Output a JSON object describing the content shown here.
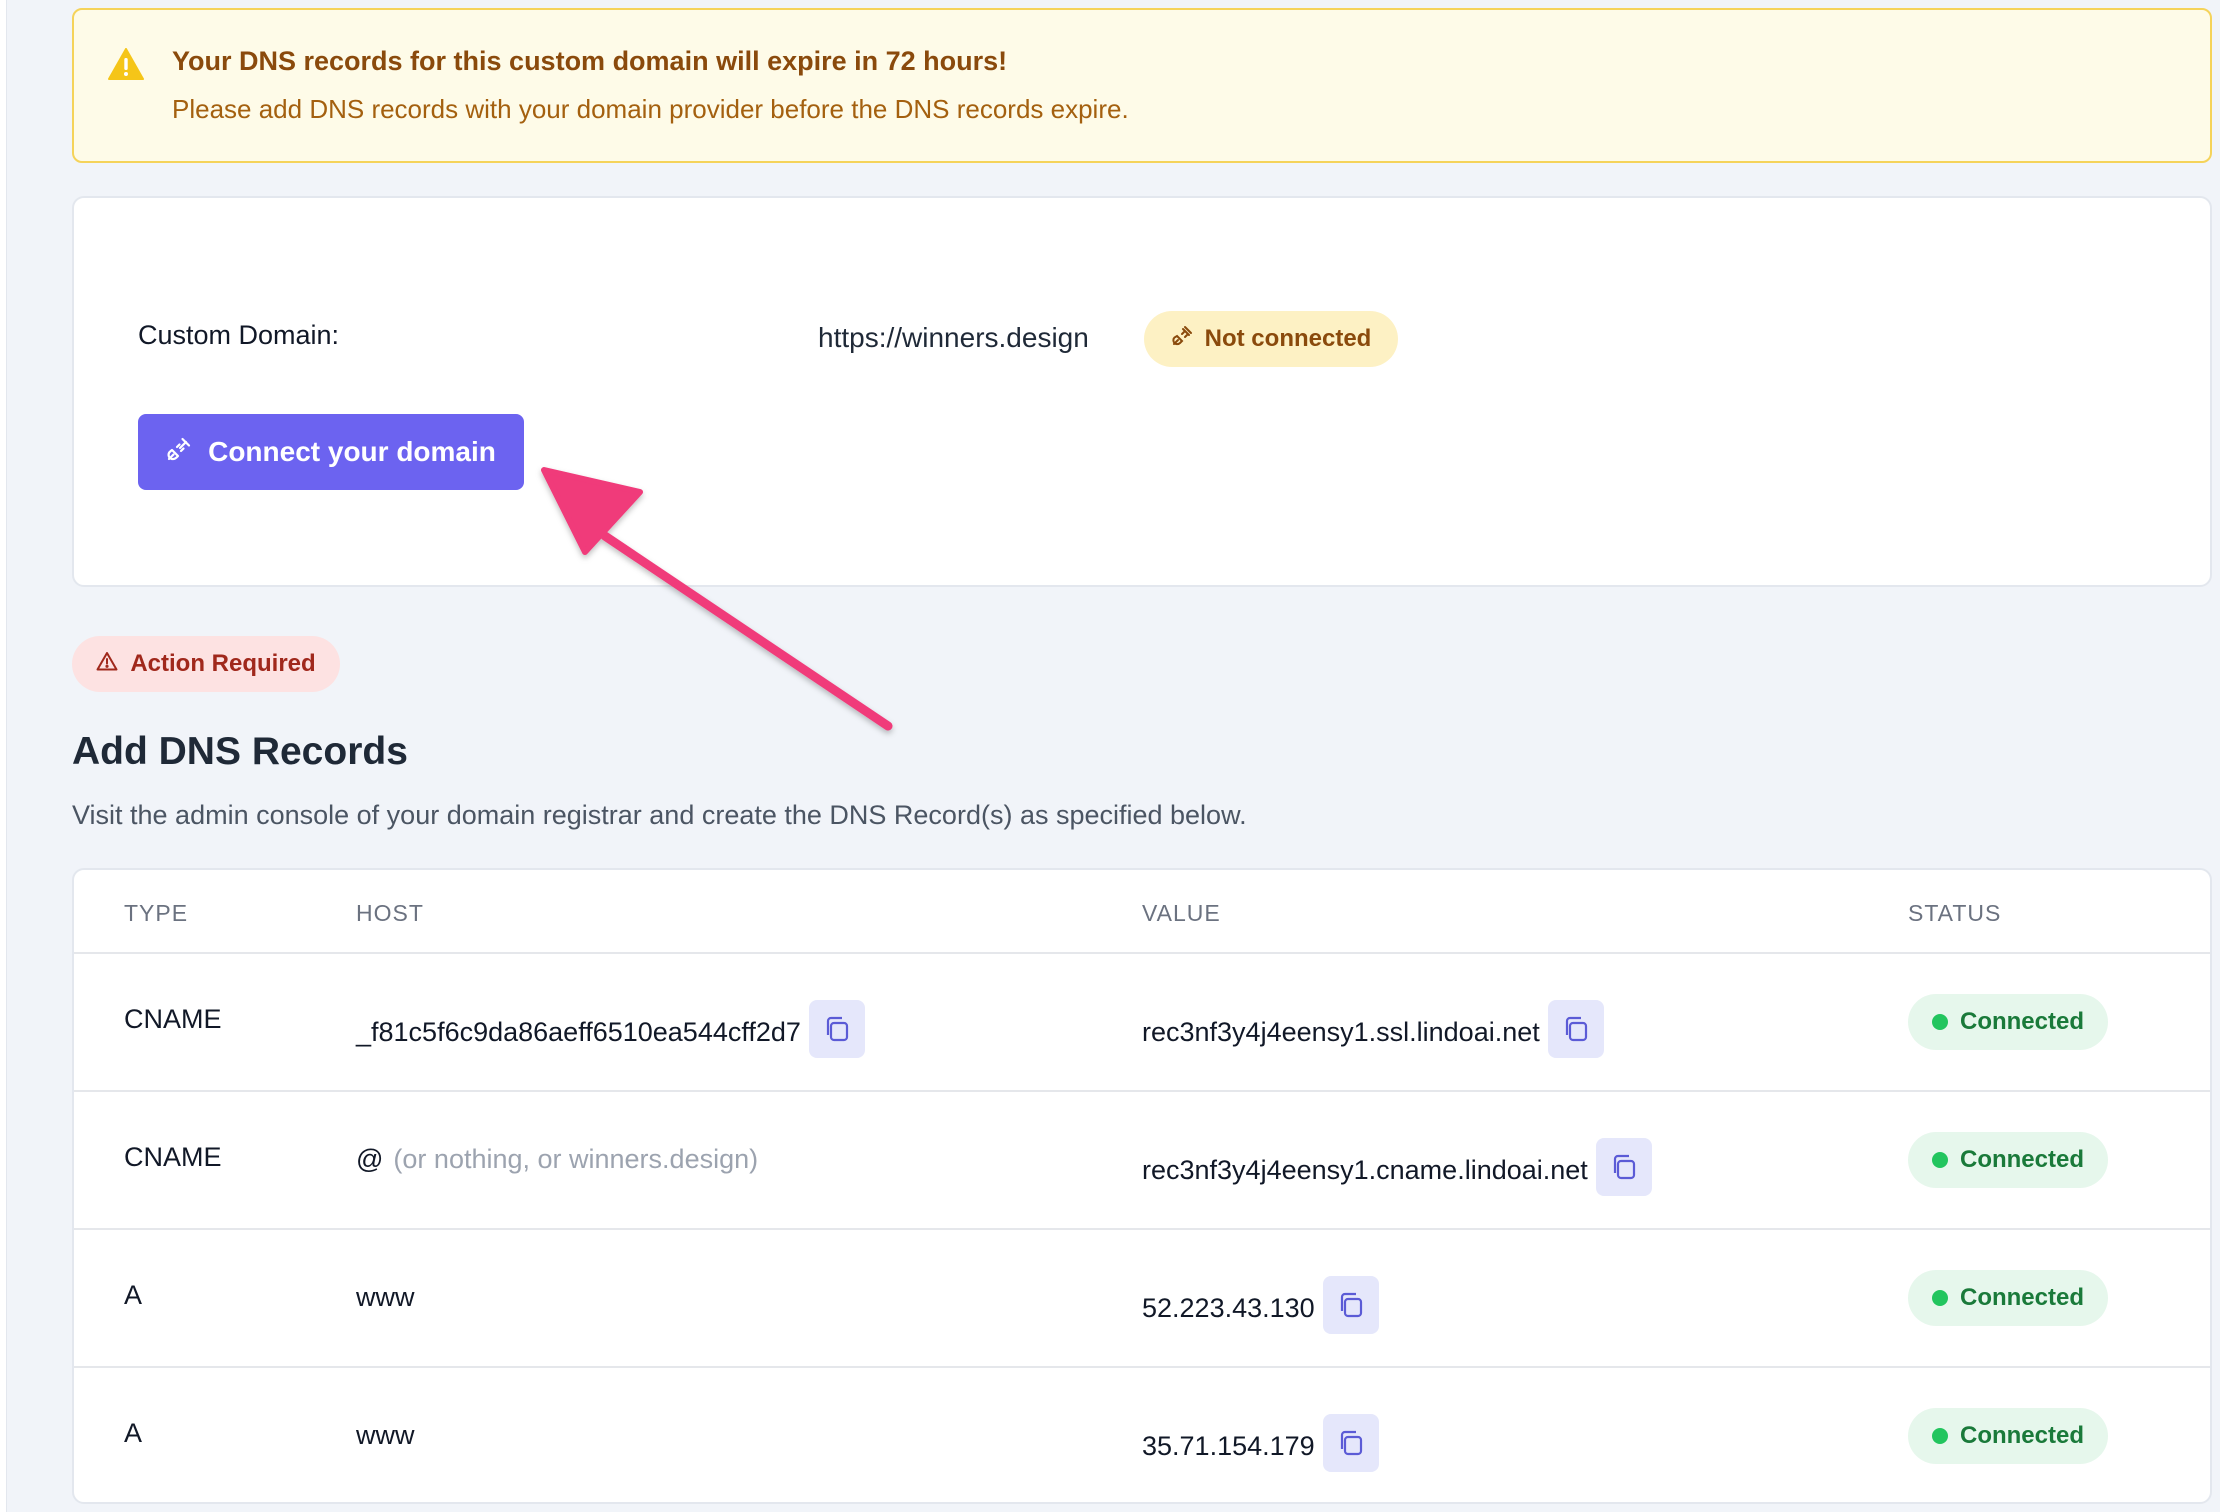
{
  "warning": {
    "icon": "warning-triangle-icon",
    "title": "Your DNS records for this custom domain will expire in 72 hours!",
    "text": "Please add DNS records with your domain provider before the DNS records expire.",
    "color": "#f5c518"
  },
  "domain": {
    "label": "Custom Domain:",
    "url": "https://winners.design",
    "status_icon": "unplugged-icon",
    "status": "Not connected",
    "connect_icon": "plug-icon",
    "connect_label": "Connect your domain",
    "accent": "#6c63f0"
  },
  "action": {
    "icon": "alert-triangle-icon",
    "label": "Action Required"
  },
  "dns": {
    "title": "Add DNS Records",
    "description": "Visit the admin console of your domain registrar and create the DNS Record(s) as specified below.",
    "columns": {
      "type": "TYPE",
      "host": "HOST",
      "value": "VALUE",
      "status": "STATUS"
    },
    "rows": [
      {
        "type": "CNAME",
        "host": "_f81c5f6c9da86aeff6510ea544cff2d7",
        "host_hint": "",
        "value": "rec3nf3y4j4eensy1.ssl.lindoai.net",
        "status": "Connected"
      },
      {
        "type": "CNAME",
        "host": "@",
        "host_hint": "(or nothing, or winners.design)",
        "value": "rec3nf3y4j4eensy1.cname.lindoai.net",
        "status": "Connected"
      },
      {
        "type": "A",
        "host": "www",
        "host_hint": "",
        "value": "52.223.43.130",
        "status": "Connected"
      },
      {
        "type": "A",
        "host": "www",
        "host_hint": "",
        "value": "35.71.154.179",
        "status": "Connected"
      }
    ],
    "copy_icon": "copy-icon",
    "status_color": "#22c55e"
  },
  "annotation": {
    "arrow_icon": "pointer-arrow-icon",
    "color": "#f03a7a"
  }
}
